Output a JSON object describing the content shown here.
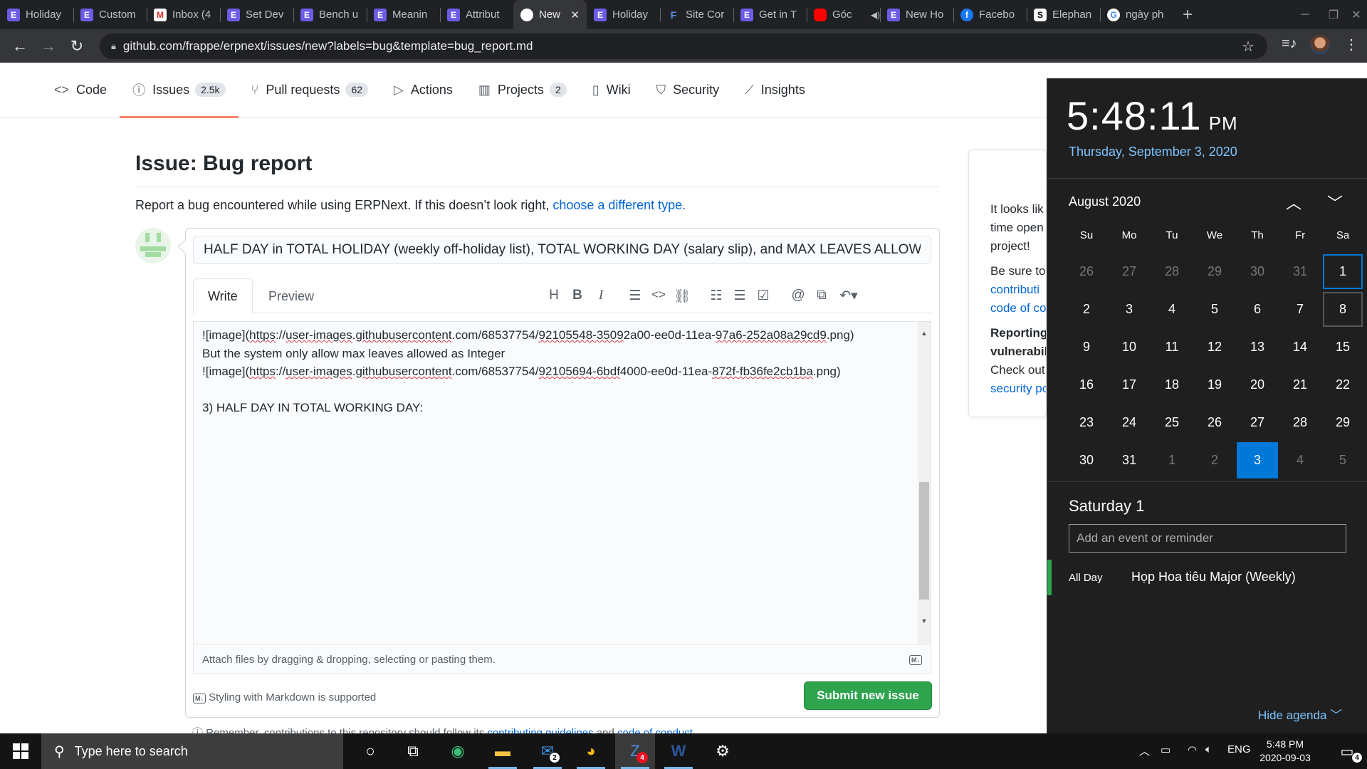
{
  "browser": {
    "tabs": [
      {
        "label": "Holiday",
        "icon": "erpnext-icon",
        "fav": "E"
      },
      {
        "label": "Custom",
        "icon": "erpnext-icon",
        "fav": "E"
      },
      {
        "label": "Inbox (4",
        "icon": "gmail-icon",
        "fav": "M"
      },
      {
        "label": "Set Dev",
        "icon": "erpnext-icon",
        "fav": "E"
      },
      {
        "label": "Bench u",
        "icon": "erpnext-icon",
        "fav": "E"
      },
      {
        "label": "Meanin",
        "icon": "erpnext-icon",
        "fav": "E"
      },
      {
        "label": "Attribut",
        "icon": "erpnext-icon",
        "fav": "E"
      },
      {
        "label": "New",
        "icon": "github-icon",
        "fav": "",
        "active": true
      },
      {
        "label": "Holiday",
        "icon": "erpnext-icon",
        "fav": "E"
      },
      {
        "label": "Site Cor",
        "icon": "frappe-icon",
        "fav": "F"
      },
      {
        "label": "Get in T",
        "icon": "erpnext-icon",
        "fav": "E"
      },
      {
        "label": "Góc",
        "icon": "youtube-icon",
        "fav": "",
        "audio": true
      },
      {
        "label": "New Ho",
        "icon": "erpnext-icon",
        "fav": "E"
      },
      {
        "label": "Facebo",
        "icon": "facebook-icon",
        "fav": "f"
      },
      {
        "label": "Elephan",
        "icon": "elephant-icon",
        "fav": "S"
      },
      {
        "label": "ngày ph",
        "icon": "google-icon",
        "fav": "G"
      }
    ],
    "url": "github.com/frappe/erpnext/issues/new?labels=bug&template=bug_report.md"
  },
  "repo_nav": {
    "tabs": [
      {
        "label": "Code",
        "icon": "code-icon",
        "glyph": "<>",
        "count": ""
      },
      {
        "label": "Issues",
        "icon": "issue-icon",
        "glyph": "ⓘ",
        "count": "2.5k",
        "selected": true
      },
      {
        "label": "Pull requests",
        "icon": "pull-request-icon",
        "glyph": "⑂",
        "count": "62"
      },
      {
        "label": "Actions",
        "icon": "actions-icon",
        "glyph": "▷",
        "count": ""
      },
      {
        "label": "Projects",
        "icon": "projects-icon",
        "glyph": "▥",
        "count": "2"
      },
      {
        "label": "Wiki",
        "icon": "wiki-icon",
        "glyph": "▯",
        "count": ""
      },
      {
        "label": "Security",
        "icon": "shield-icon",
        "glyph": "⛉",
        "count": ""
      },
      {
        "label": "Insights",
        "icon": "graph-icon",
        "glyph": "⟋",
        "count": ""
      }
    ]
  },
  "issue": {
    "heading": "Issue: Bug report",
    "description": "Report a bug encountered while using ERPNext. If this doesn’t look right,",
    "description_link": "choose a different type.",
    "title_value": "HALF DAY in TOTAL HOLIDAY (weekly off-holiday list), TOTAL WORKING DAY (salary slip), and MAX LEAVES ALLOWED",
    "write_tab": "Write",
    "preview_tab": "Preview",
    "body_lines": [
      "![image](https://user-images.githubusercontent.com/68537754/92105548-35092a00-ee0d-11ea-97a6-252a08a29cd9.png)",
      "But the system only allow max leaves allowed as Integer",
      "![image](https://user-images.githubusercontent.com/68537754/92105694-6bdf4000-ee0d-11ea-872f-fb36fe2cb1ba.png)",
      "",
      "3) HALF DAY IN TOTAL WORKING DAY:"
    ],
    "attach_hint": "Attach files by dragging & dropping, selecting or pasting them.",
    "markdown_note": "Styling with Markdown is supported",
    "submit_label": "Submit new issue",
    "remember_text": "Remember, contributions to this repository should follow its",
    "remember_link1": "contributing guidelines",
    "remember_and": "and",
    "remember_link2": "code of conduct"
  },
  "side_card": {
    "lines": [
      "It looks lik",
      "time open",
      "project!",
      "Be sure to",
      "contributi",
      "code of co",
      "Reporting",
      "vulnerabil",
      "Check out",
      "security po"
    ]
  },
  "calendar": {
    "time": "5:48:11",
    "ampm": "PM",
    "long_date": "Thursday, September 3, 2020",
    "month_title": "August 2020",
    "weekdays": [
      "Su",
      "Mo",
      "Tu",
      "We",
      "Th",
      "Fr",
      "Sa"
    ],
    "days": [
      {
        "d": "26",
        "dim": true
      },
      {
        "d": "27",
        "dim": true
      },
      {
        "d": "28",
        "dim": true
      },
      {
        "d": "29",
        "dim": true
      },
      {
        "d": "30",
        "dim": true
      },
      {
        "d": "31",
        "dim": true
      },
      {
        "d": "1",
        "selected": true
      },
      {
        "d": "2"
      },
      {
        "d": "3"
      },
      {
        "d": "4"
      },
      {
        "d": "5"
      },
      {
        "d": "6"
      },
      {
        "d": "7"
      },
      {
        "d": "8",
        "hover": true
      },
      {
        "d": "9"
      },
      {
        "d": "10"
      },
      {
        "d": "11"
      },
      {
        "d": "12"
      },
      {
        "d": "13"
      },
      {
        "d": "14"
      },
      {
        "d": "15"
      },
      {
        "d": "16"
      },
      {
        "d": "17"
      },
      {
        "d": "18"
      },
      {
        "d": "19"
      },
      {
        "d": "20"
      },
      {
        "d": "21"
      },
      {
        "d": "22"
      },
      {
        "d": "23"
      },
      {
        "d": "24"
      },
      {
        "d": "25"
      },
      {
        "d": "26"
      },
      {
        "d": "27"
      },
      {
        "d": "28"
      },
      {
        "d": "29"
      },
      {
        "d": "30"
      },
      {
        "d": "31"
      },
      {
        "d": "1",
        "dim": true
      },
      {
        "d": "2",
        "dim": true
      },
      {
        "d": "3",
        "today": true
      },
      {
        "d": "4",
        "dim": true
      },
      {
        "d": "5",
        "dim": true
      }
    ],
    "agenda_date": "Saturday 1",
    "event_placeholder": "Add an event or reminder",
    "event_time": "All Day",
    "event_name": "Họp Hoa tiêu Major (Weekly)",
    "hide_agenda": "Hide agenda"
  },
  "taskbar": {
    "search_placeholder": "Type here to search",
    "lang": "ENG",
    "time": "5:48 PM",
    "date": "2020-09-03",
    "mail_badge": "2",
    "zalo_badge": "4",
    "notif_badge": "4"
  },
  "colors": {
    "accent_green": "#2ea44f",
    "link_blue": "#0366d6",
    "win_accent": "#0078d7",
    "issues_underline": "#f9826c"
  }
}
